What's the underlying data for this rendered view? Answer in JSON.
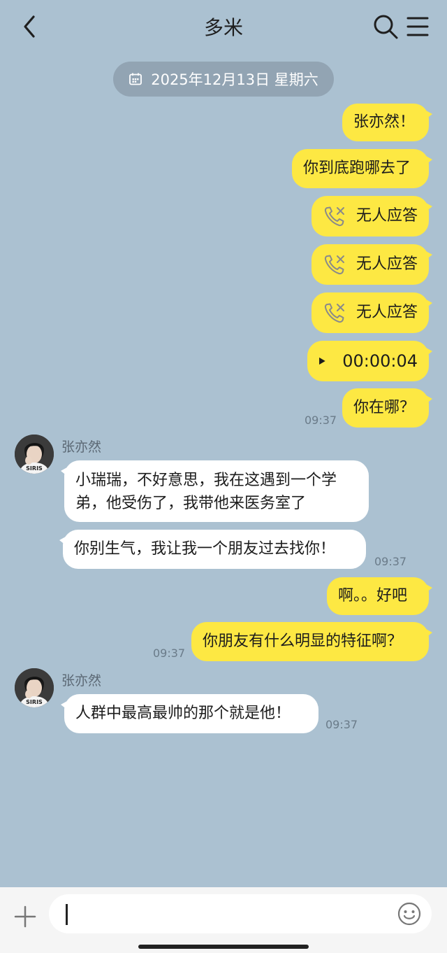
{
  "header": {
    "title": "多米"
  },
  "date_divider": "2025年12月13日 星期六",
  "messages": [
    {
      "text": "张亦然！"
    },
    {
      "text": "你到底跑哪去了"
    },
    {
      "text": "无人应答"
    },
    {
      "text": "无人应答"
    },
    {
      "text": "无人应答"
    },
    {
      "text": "00:00:04"
    },
    {
      "text": "你在哪？",
      "time": "09:37"
    },
    {
      "sender": "张亦然",
      "text": "小瑞瑞，不好意思，我在这遇到一个学弟，他受伤了，我带他来医务室了"
    },
    {
      "text": "你别生气，我让我一个朋友过去找你！",
      "time": "09:37"
    },
    {
      "text": "啊。。好吧"
    },
    {
      "text": "你朋友有什么明显的特征啊？",
      "time": "09:37"
    },
    {
      "sender": "张亦然",
      "text": "人群中最高最帅的那个就是他！",
      "time": "09:37"
    }
  ],
  "avatar_caption": "SIRIS",
  "colors": {
    "background": "#abc1d1",
    "my_bubble": "#fde843",
    "their_bubble": "#ffffff"
  }
}
